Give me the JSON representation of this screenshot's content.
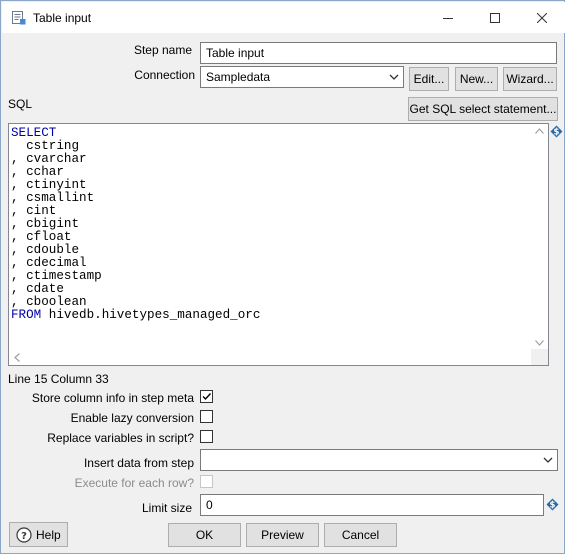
{
  "window": {
    "title": "Table input",
    "icon": "table-input-icon",
    "controls": [
      "minimize-icon",
      "maximize-icon",
      "close-icon"
    ]
  },
  "step_name": {
    "label": "Step name",
    "value": "Table input"
  },
  "connection": {
    "label": "Connection",
    "value": "Sampledata",
    "edit_label": "Edit...",
    "new_label": "New...",
    "wizard_label": "Wizard..."
  },
  "sql": {
    "label": "SQL",
    "get_sql_label": "Get SQL select statement...",
    "lines": [
      {
        "kw": "SELECT",
        "text": ""
      },
      {
        "kw": "",
        "text": "  cstring"
      },
      {
        "kw": "",
        "text": ", cvarchar"
      },
      {
        "kw": "",
        "text": ", cchar"
      },
      {
        "kw": "",
        "text": ", ctinyint"
      },
      {
        "kw": "",
        "text": ", csmallint"
      },
      {
        "kw": "",
        "text": ", cint"
      },
      {
        "kw": "",
        "text": ", cbigint"
      },
      {
        "kw": "",
        "text": ", cfloat"
      },
      {
        "kw": "",
        "text": ", cdouble"
      },
      {
        "kw": "",
        "text": ", cdecimal"
      },
      {
        "kw": "",
        "text": ", ctimestamp"
      },
      {
        "kw": "",
        "text": ", cdate"
      },
      {
        "kw": "",
        "text": ", cboolean"
      },
      {
        "kw": "FROM",
        "text": " hivedb.hivetypes_managed_orc"
      }
    ]
  },
  "status": {
    "position": "Line 15 Column 33"
  },
  "options": {
    "store_column_info": {
      "label": "Store column info in step meta",
      "checked": true
    },
    "lazy_conversion": {
      "label": "Enable lazy conversion",
      "checked": false
    },
    "replace_variables": {
      "label": "Replace variables in script?",
      "checked": false
    },
    "insert_data_from_step": {
      "label": "Insert data from step",
      "value": ""
    },
    "execute_each_row": {
      "label": "Execute for each row?",
      "checked": false,
      "enabled": false
    },
    "limit_size": {
      "label": "Limit size",
      "value": "0"
    }
  },
  "footer": {
    "help_label": "Help",
    "ok_label": "OK",
    "preview_label": "Preview",
    "cancel_label": "Cancel"
  },
  "colors": {
    "keyword": "#0000aa",
    "variable_icon": "#2b6aa8"
  }
}
